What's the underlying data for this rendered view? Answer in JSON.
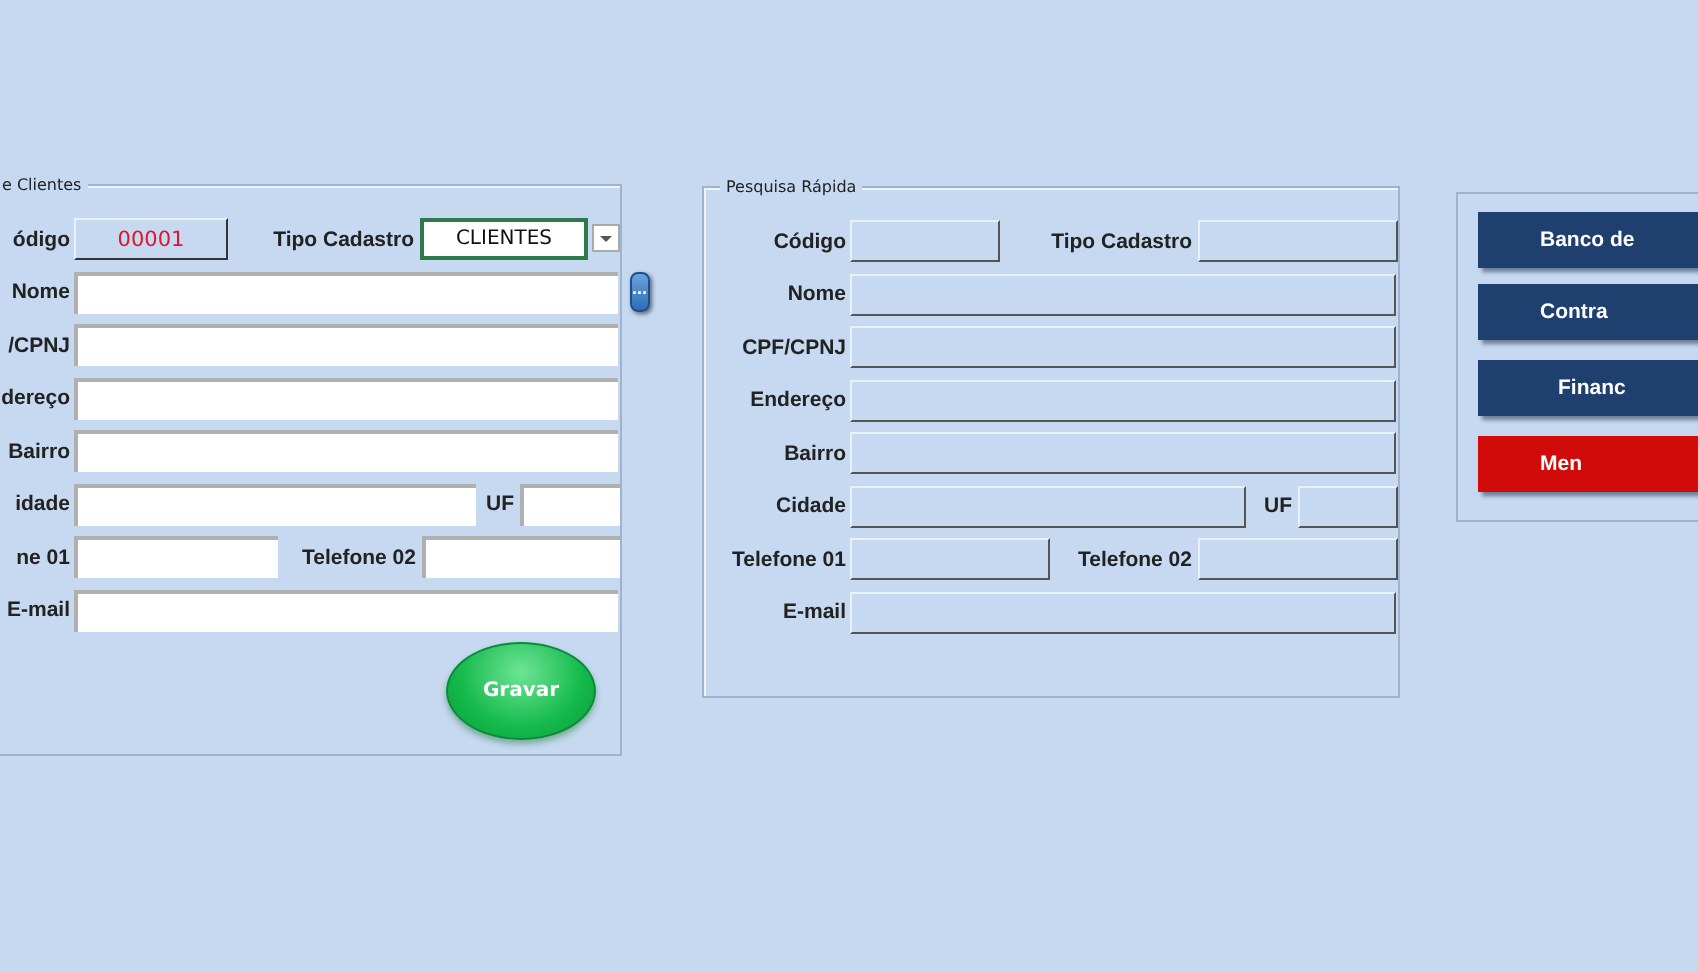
{
  "cadastro": {
    "legend": "e Clientes",
    "rows": [
      {
        "fields": [
          {
            "label": "ódigo",
            "kind": "code",
            "value": "00001"
          },
          {
            "label": "Tipo Cadastro",
            "kind": "combo",
            "value": "CLIENTES"
          }
        ]
      },
      {
        "fields": [
          {
            "label": "Nome",
            "kind": "text"
          }
        ],
        "button": "..."
      },
      {
        "fields": [
          {
            "label": "/CPNJ",
            "kind": "text"
          }
        ]
      },
      {
        "fields": [
          {
            "label": "dereço",
            "kind": "text"
          }
        ]
      },
      {
        "fields": [
          {
            "label": "Bairro",
            "kind": "text"
          }
        ]
      },
      {
        "fields": [
          {
            "label": "idade",
            "kind": "text"
          },
          {
            "label": "UF",
            "kind": "text"
          }
        ]
      },
      {
        "fields": [
          {
            "label": "ne 01",
            "kind": "text"
          },
          {
            "label": "Telefone 02",
            "kind": "text"
          }
        ]
      },
      {
        "fields": [
          {
            "label": "E-mail",
            "kind": "text"
          }
        ]
      }
    ],
    "save_button": "Gravar"
  },
  "pesquisa": {
    "legend": "Pesquisa Rápida",
    "rows": [
      {
        "fields": [
          {
            "label": "Código",
            "kind": "readonly"
          },
          {
            "label": "Tipo Cadastro",
            "kind": "readonly"
          }
        ]
      },
      {
        "fields": [
          {
            "label": "Nome",
            "kind": "readonly"
          }
        ]
      },
      {
        "fields": [
          {
            "label": "CPF/CPNJ",
            "kind": "readonly"
          }
        ]
      },
      {
        "fields": [
          {
            "label": "Endereço",
            "kind": "readonly"
          }
        ]
      },
      {
        "fields": [
          {
            "label": "Bairro",
            "kind": "readonly"
          }
        ]
      },
      {
        "fields": [
          {
            "label": "Cidade",
            "kind": "readonly"
          },
          {
            "label": "UF",
            "kind": "readonly"
          }
        ]
      },
      {
        "fields": [
          {
            "label": "Telefone 01",
            "kind": "readonly"
          },
          {
            "label": "Telefone 02",
            "kind": "readonly"
          }
        ]
      },
      {
        "fields": [
          {
            "label": "E-mail",
            "kind": "readonly"
          }
        ]
      }
    ]
  },
  "menu_buttons": [
    {
      "label": "Banco de",
      "color": "#1f3f6e"
    },
    {
      "label": "Contra",
      "color": "#1f3f6e"
    },
    {
      "label": "Financ",
      "color": "#1f3f6e"
    },
    {
      "label": "Men",
      "color": "#d10a0a"
    }
  ]
}
